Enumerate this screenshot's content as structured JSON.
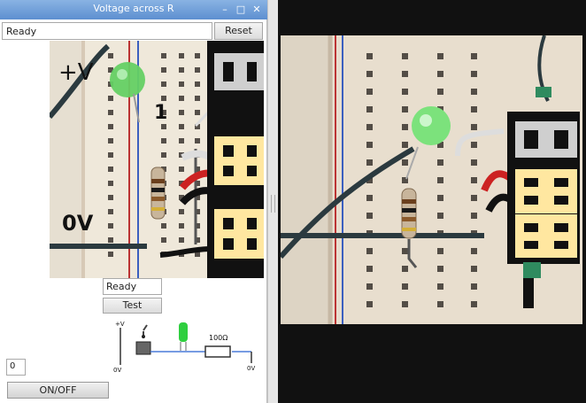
{
  "window": {
    "title": "Voltage across R",
    "controls": {
      "minimize": "–",
      "maximize": "□",
      "close": "✕"
    }
  },
  "top": {
    "status_value": "Ready",
    "reset_label": "Reset"
  },
  "camera_left": {
    "annotations": {
      "plus_v": "+V",
      "one": "1",
      "zero_v": "0V"
    }
  },
  "controls": {
    "mini_status_value": "Ready",
    "test_label": "Test",
    "counter_value": "0",
    "onoff_label": "ON/OFF"
  },
  "circuit": {
    "plus_v": "+V",
    "zero_v_left": "0V",
    "resistor_label": "100Ω",
    "zero_v_right": "0V"
  },
  "colors": {
    "titlebar": "#6b9bd6",
    "led_green": "#6bd36b",
    "segment_on": "#ffe7a0",
    "wire_dark": "#2b3a3f"
  }
}
